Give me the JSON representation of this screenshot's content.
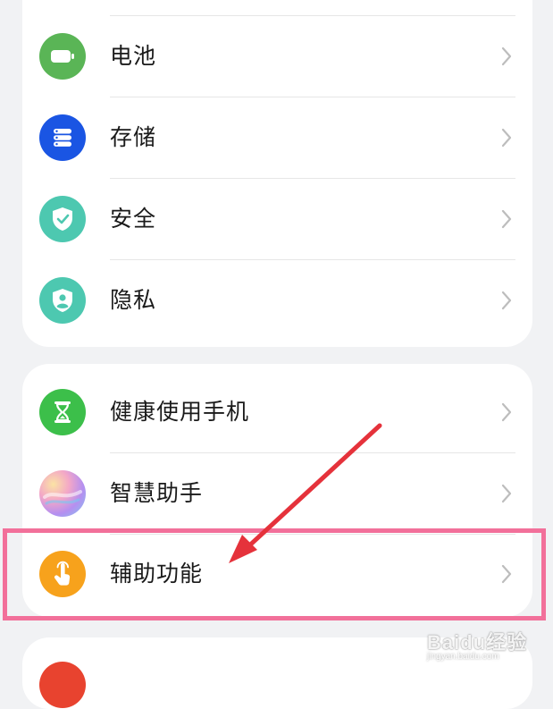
{
  "settings_group_1": {
    "items": [
      {
        "label": "电池",
        "icon": "battery-icon",
        "icon_color": "#5ab556"
      },
      {
        "label": "存储",
        "icon": "storage-icon",
        "icon_color": "#1a55e3"
      },
      {
        "label": "安全",
        "icon": "shield-check-icon",
        "icon_color": "#4dc8b0"
      },
      {
        "label": "隐私",
        "icon": "privacy-icon",
        "icon_color": "#4dc8b0"
      }
    ]
  },
  "settings_group_2": {
    "items": [
      {
        "label": "健康使用手机",
        "icon": "hourglass-icon",
        "icon_color": "#3cbf4a"
      },
      {
        "label": "智慧助手",
        "icon": "assistant-orb-icon",
        "icon_color": "gradient"
      },
      {
        "label": "辅助功能",
        "icon": "hand-tap-icon",
        "icon_color": "#f7a21c"
      }
    ]
  },
  "annotation": {
    "highlight_color": "#f2709a",
    "arrow_color": "#e5323b"
  },
  "watermark": {
    "text": "Baidu经验",
    "sub": "jingyan.baidu.com"
  }
}
